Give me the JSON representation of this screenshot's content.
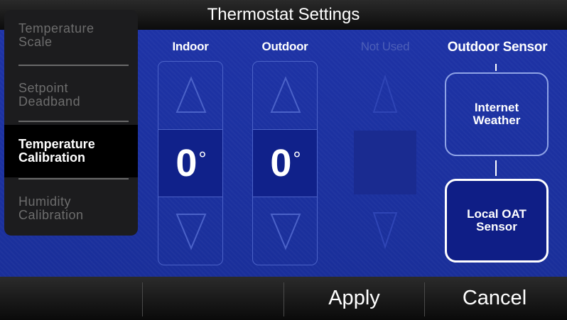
{
  "title": "Thermostat Settings",
  "sidebar": {
    "items": [
      {
        "label_line1": "Temperature",
        "label_line2": "Scale"
      },
      {
        "label_line1": "Setpoint",
        "label_line2": "Deadband"
      },
      {
        "label_line1": "Temperature",
        "label_line2": "Calibration"
      },
      {
        "label_line1": "Humidity",
        "label_line2": "Calibration"
      }
    ],
    "active_item": "Temperature Calibration"
  },
  "columns": {
    "indoor": {
      "label": "Indoor",
      "value": "0",
      "unit": "°"
    },
    "outdoor": {
      "label": "Outdoor",
      "value": "0",
      "unit": "°"
    },
    "unused": {
      "label": "Not Used"
    }
  },
  "outdoor_sensor": {
    "heading": "Outdoor Sensor",
    "options": [
      {
        "line1": "Internet",
        "line2": "Weather",
        "selected": false
      },
      {
        "line1": "Local OAT",
        "line2": "Sensor",
        "selected": true
      }
    ]
  },
  "footer": {
    "apply_label": "Apply",
    "cancel_label": "Cancel"
  },
  "icons": {
    "increment": "up-triangle-icon",
    "decrement": "down-triangle-icon"
  },
  "colors": {
    "panel_blue": "#1e33a6",
    "value_blue": "#10218a",
    "selected_blue": "#0f1e86"
  }
}
